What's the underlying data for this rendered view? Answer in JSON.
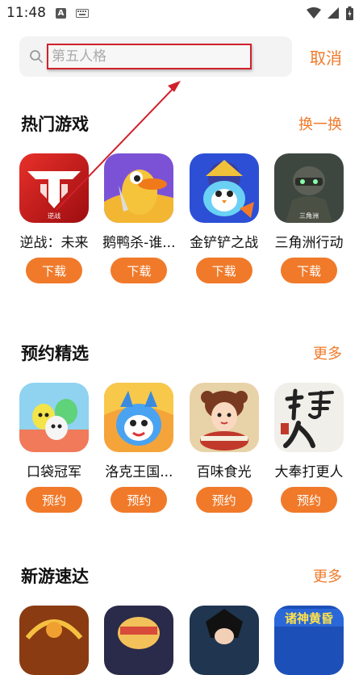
{
  "status": {
    "time": "11:48",
    "a_badge": "A"
  },
  "search": {
    "placeholder": "第五人格",
    "cancel_label": "取消"
  },
  "sections": [
    {
      "title": "热门游戏",
      "action": "换一换",
      "games": [
        {
          "name": "逆战：未来",
          "button": "下载",
          "icon": "nizhan-logo-icon"
        },
        {
          "name": "鹅鸭杀-谁...",
          "button": "下载",
          "icon": "goose-duck-icon"
        },
        {
          "name": "金铲铲之战",
          "button": "下载",
          "icon": "penguin-hero-icon"
        },
        {
          "name": "三角洲行动",
          "button": "下载",
          "icon": "soldier-icon"
        }
      ]
    },
    {
      "title": "预约精选",
      "action": "更多",
      "games": [
        {
          "name": "口袋冠军",
          "button": "预约",
          "icon": "blob-characters-icon"
        },
        {
          "name": "洛克王国...",
          "button": "预约",
          "icon": "roco-creature-icon"
        },
        {
          "name": "百味食光",
          "button": "预约",
          "icon": "food-girl-icon"
        },
        {
          "name": "大奉打更人",
          "button": "预约",
          "icon": "calligraphy-icon"
        }
      ]
    },
    {
      "title": "新游速达",
      "action": "更多",
      "games": [
        {
          "name": "",
          "button": "",
          "icon": "dragon-armor-icon"
        },
        {
          "name": "",
          "button": "",
          "icon": "cartoon-hero-icon"
        },
        {
          "name": "",
          "button": "",
          "icon": "anime-swordsman-icon"
        },
        {
          "name": "",
          "button": "",
          "icon": "team-banner-icon",
          "banner_text": "诸神黄昏"
        }
      ]
    }
  ],
  "colors": {
    "accent": "#f07a2a",
    "annotation": "#d0212b"
  }
}
